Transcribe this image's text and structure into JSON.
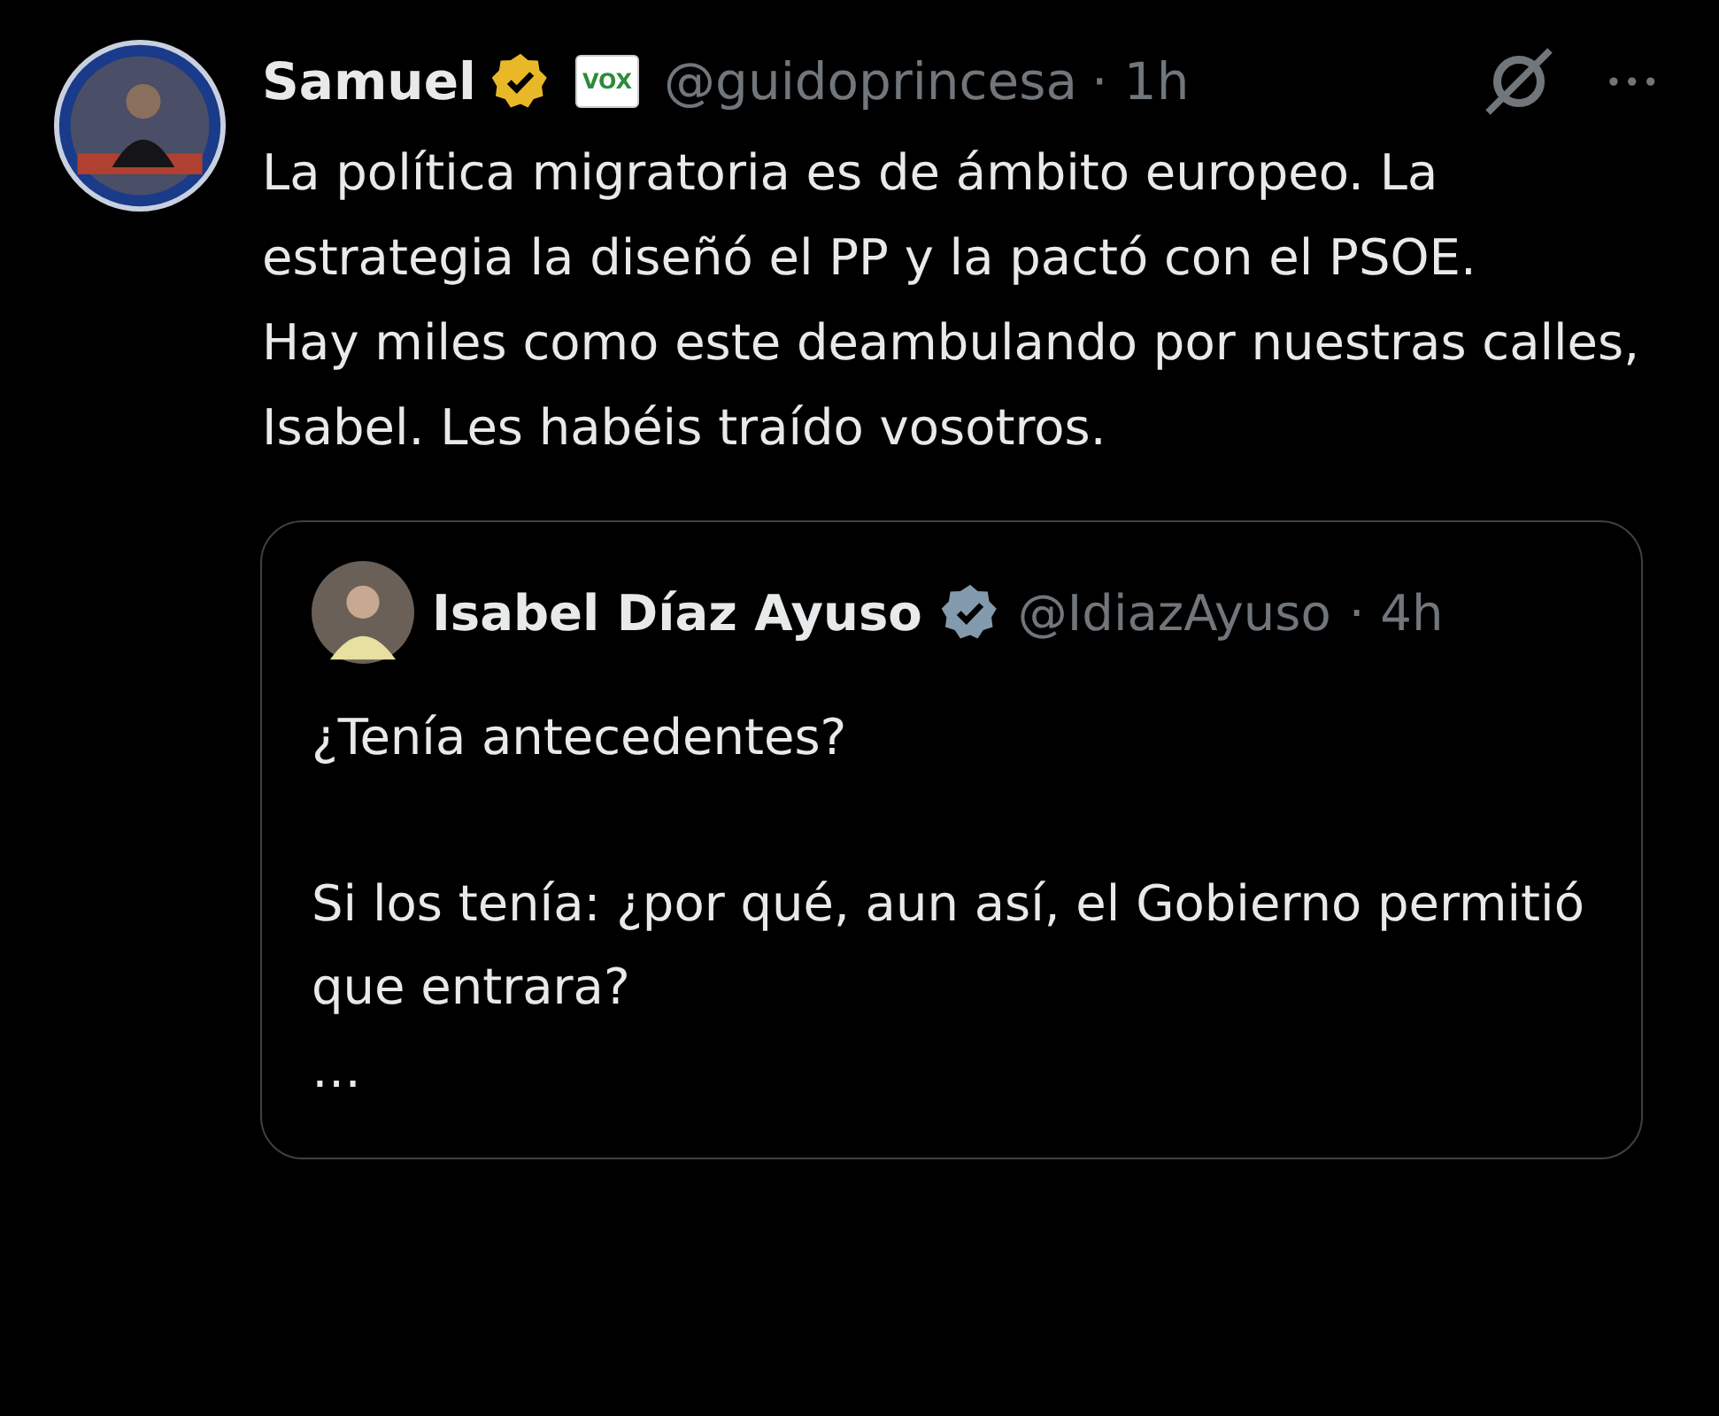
{
  "post": {
    "author": "Samuel",
    "badge": {
      "kind": "gold"
    },
    "affiliate": "VOX",
    "handle": "@guidoprincesa",
    "time": "· 1h",
    "paragraphs": [
      "La política migratoria es de ámbito europeo. La estrategia la diseñó el PP y la  pactó con el PSOE.",
      "Hay miles como este deambulando por nuestras calles, Isabel. Les habéis traído vosotros."
    ]
  },
  "quote": {
    "author": "Isabel Díaz Ayuso",
    "badge": {
      "kind": "gray"
    },
    "handle": "@IdiazAyuso",
    "time": "· 4h",
    "paragraphs": [
      "¿Tenía antecedentes?",
      "Si los tenía: ¿por qué, aun así, el Gobierno permitió que entrara?",
      "…"
    ]
  },
  "more": "•••"
}
